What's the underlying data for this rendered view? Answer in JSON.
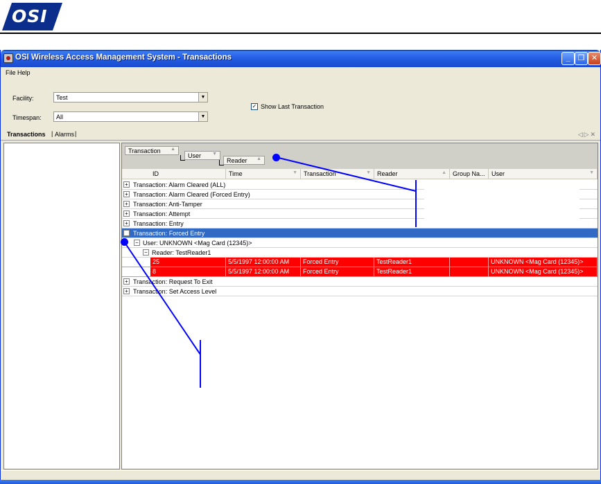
{
  "logo": {
    "text": "OSI",
    "color": "#0b2e8c"
  },
  "window": {
    "title": "OSI Wireless Access Management System - Transactions",
    "icon": "app-icon",
    "controls": [
      "minimize-icon",
      "restore-icon",
      "close-icon"
    ]
  },
  "menu": {
    "file": "File",
    "help": "Help"
  },
  "filters": {
    "facility_label": "Facility:",
    "facility_value": "Test",
    "timespan_label": "Timespan:",
    "timespan_value": "All",
    "show_last_label": "Show Last Transaction",
    "show_last_checked": true
  },
  "tabs": {
    "transactions": "Transactions",
    "alarms": "Alarms"
  },
  "groupby": {
    "g1": "Transaction",
    "g2": "User",
    "g3": "Reader"
  },
  "columns": [
    "ID",
    "Time",
    "Transaction",
    "Reader",
    "Group Na...",
    "User"
  ],
  "groups": {
    "r0": "Transaction:  Alarm Cleared (ALL)",
    "r1": "Transaction:  Alarm Cleared (Forced Entry)",
    "r2": "Transaction:  Anti-Tamper",
    "r3": "Transaction:  Attempt",
    "r4": "Transaction:  Entry",
    "r5": "Transaction:  Forced Entry",
    "r6": "User:  UNKNOWN <Mag Card (12345)>",
    "r7": "Reader:  TestReader1",
    "r10": "Transaction:  Request To Exit",
    "r11": "Transaction:  Set Access Level"
  },
  "records": [
    {
      "id": "25",
      "time": "5/5/1997 12:00:00 AM",
      "transaction": "Forced Entry",
      "reader": "TestReader1",
      "group": "",
      "user": "UNKNOWN <Mag Card (12345)>"
    },
    {
      "id": "8",
      "time": "5/5/1997 12:00:00 AM",
      "transaction": "Forced Entry",
      "reader": "TestReader1",
      "group": "",
      "user": "UNKNOWN <Mag Card (12345)>"
    }
  ],
  "colors": {
    "selected_row": "#316ac5",
    "alert_row": "#ff0000",
    "callout": "#0000ff"
  }
}
